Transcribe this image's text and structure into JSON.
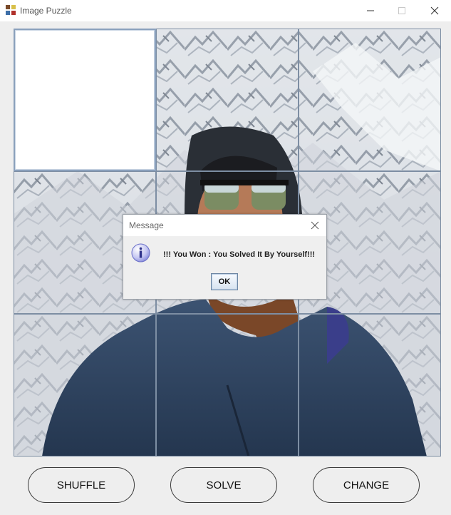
{
  "window": {
    "title": "Image Puzzle"
  },
  "dialog": {
    "title": "Message",
    "message": "!!! You Won : You Solved It By Yourself!!!",
    "ok_label": "OK"
  },
  "buttons": {
    "shuffle_label": "SHUFFLE",
    "solve_label": "SOLVE",
    "change_label": "CHANGE"
  },
  "board": {
    "rows": 3,
    "cols": 3,
    "blank_tile_index": 0
  },
  "icons": {
    "app": "puzzle-app-icon",
    "minimize": "minimize-icon",
    "maximize": "maximize-icon",
    "close": "close-icon",
    "dialog_close": "close-icon",
    "dialog_info": "info-icon"
  },
  "colors": {
    "tile_border": "#7d8ea3",
    "info_icon": "#7b7fd6"
  }
}
